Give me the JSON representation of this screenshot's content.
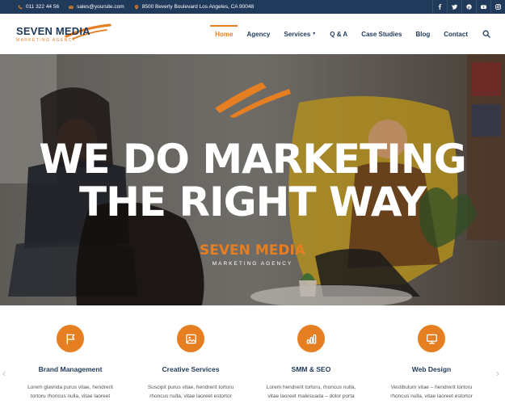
{
  "topbar": {
    "phone": "011 322 44 56",
    "email": "sales@yoursite.com",
    "address": "8500 Beverly Boulevard Los Angeles, CA 90048",
    "socials": [
      "f",
      "t",
      "p",
      "yt",
      "ig"
    ]
  },
  "logo": {
    "main": "SEVEN MEDIA",
    "sub": "MARKETING AGENCY"
  },
  "nav": {
    "items": [
      "Home",
      "Agency",
      "Services",
      "Q & A",
      "Case Studies",
      "Blog",
      "Contact"
    ],
    "active": "Home"
  },
  "hero": {
    "line1": "WE DO MARKETING",
    "line2": "THE RIGHT WAY",
    "brand": "SEVEN MEDIA",
    "tagline": "MARKETING AGENCY"
  },
  "services": [
    {
      "title": "Brand Management",
      "icon": "flag-icon",
      "desc1": "Lorem glavrida purus vitae, hendrerit",
      "desc2": "tortoru rhoncus nulla, vitae laoreet"
    },
    {
      "title": "Creative Services",
      "icon": "image-icon",
      "desc1": "Suscipit purus vitae, hendrerit tortoru",
      "desc2": "rhoncus nulla, vitae laoreet estortor"
    },
    {
      "title": "SMM & SEO",
      "icon": "chart-icon",
      "desc1": "Lorem hendrerit tortoru, rhoncus nulla,",
      "desc2": "vitae laoreet malesuada – dolor porta"
    },
    {
      "title": "Web Design",
      "icon": "monitor-icon",
      "desc1": "Vestibulum vitae – hendrerit tortoru",
      "desc2": "rhoncus nulla, vitae laoreet estortor"
    }
  ],
  "colors": {
    "navy": "#1f3a5a",
    "orange": "#e67e22"
  }
}
